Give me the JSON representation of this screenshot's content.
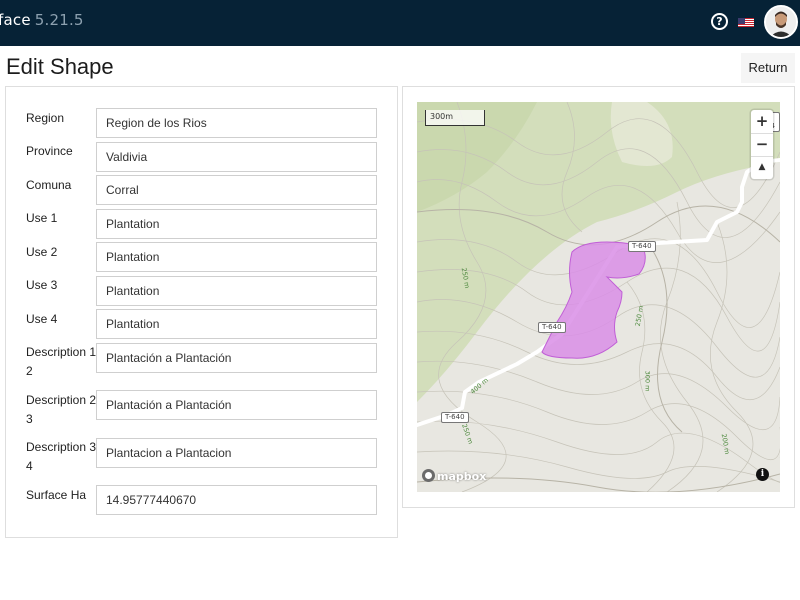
{
  "header": {
    "brand": "face",
    "version": "5.21.5",
    "help_icon": "question-circle-icon",
    "flag_icon": "us-flag-icon",
    "avatar_icon": "user-avatar"
  },
  "page": {
    "title": "Edit Shape",
    "return_label": "Return"
  },
  "form": {
    "rows": [
      {
        "label": "Region",
        "value": "Region de los Rios"
      },
      {
        "label": "Province",
        "value": "Valdivia"
      },
      {
        "label": "Comuna",
        "value": "Corral"
      },
      {
        "label": "Use 1",
        "value": "Plantation"
      },
      {
        "label": "Use 2",
        "value": "Plantation"
      },
      {
        "label": "Use 3",
        "value": "Plantation"
      },
      {
        "label": "Use 4",
        "value": "Plantation"
      },
      {
        "label": "Description 1\n2",
        "value": "Plantación a Plantación"
      },
      {
        "label": "Description 2\n3",
        "value": "Plantación a Plantación"
      },
      {
        "label": "Description 3\n4",
        "value": "Plantacion a Plantacion"
      },
      {
        "label": "Surface Ha",
        "value": "14.95777440670"
      }
    ]
  },
  "map": {
    "scale_label": "300m",
    "zoom_in": "+",
    "zoom_out": "−",
    "compass": "▲",
    "attribution": "mapbox",
    "info": "i",
    "road_labels": [
      "T-640",
      "T-640",
      "T-640",
      "T-64"
    ],
    "elevation_labels": [
      "250 m",
      "250 m",
      "400 m",
      "300 m",
      "200 m",
      "250 m"
    ],
    "colors": {
      "shape_fill": "#d98ee6",
      "shape_stroke": "#c05fd6",
      "forest": "#cfdcb0",
      "terrain": "#e8e7e1",
      "road": "#ffffff"
    }
  }
}
